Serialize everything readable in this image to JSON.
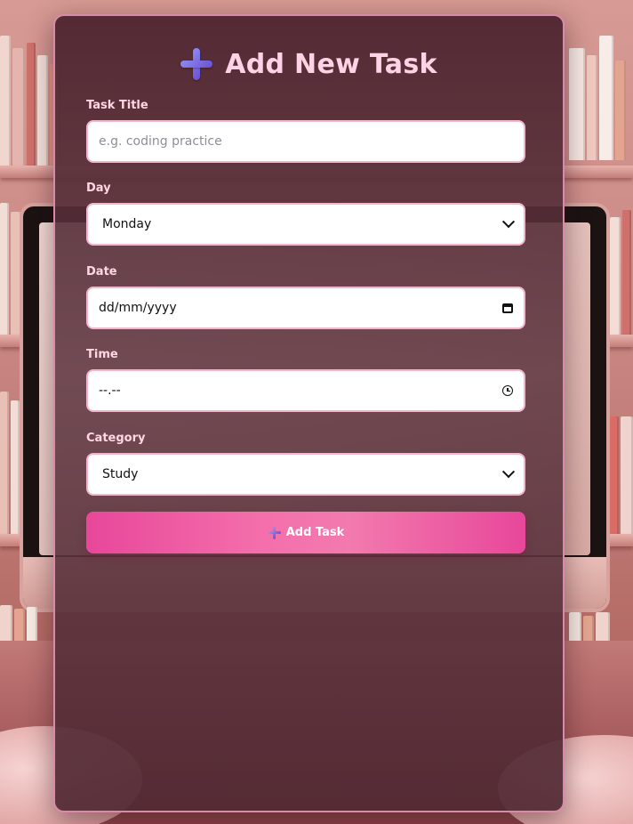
{
  "form": {
    "title": "Add New Task",
    "fields": {
      "task_title": {
        "label": "Task Title",
        "placeholder": "e.g. coding practice",
        "value": ""
      },
      "day": {
        "label": "Day",
        "value": "Monday"
      },
      "date": {
        "label": "Date",
        "value": "dd/mm/yyyy"
      },
      "time": {
        "label": "Time",
        "value": "--.--"
      },
      "category": {
        "label": "Category",
        "value": "Study"
      }
    },
    "submit_label": "Add Task"
  },
  "icons": {
    "title_icon": "plus-icon",
    "submit_icon": "plus-icon",
    "day_dropdown": "chevron-down-icon",
    "category_dropdown": "chevron-down-icon",
    "date_picker": "calendar-icon",
    "time_picker": "clock-icon"
  },
  "colors": {
    "accent": "#e8479a",
    "title_text": "#ffd2e6",
    "panel_border": "#d98aa8",
    "input_border": "#f4b5cc",
    "plus_icon": "#7a66e0"
  }
}
